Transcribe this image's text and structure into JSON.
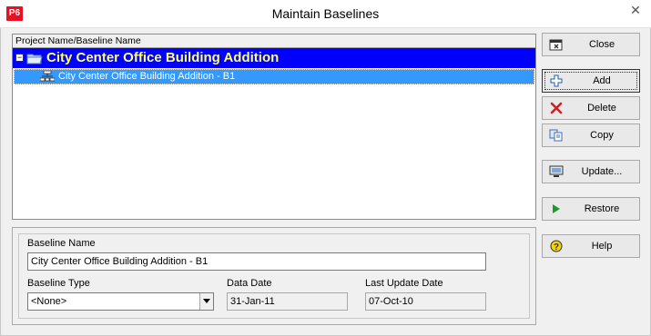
{
  "window": {
    "app_icon_text": "P6",
    "title": "Maintain Baselines"
  },
  "tree": {
    "column_header": "Project Name/Baseline Name",
    "project": {
      "name": "City Center Office Building Addition",
      "expanded": true
    },
    "baselines": [
      {
        "name": "City Center Office Building Addition - B1",
        "selected": true
      }
    ]
  },
  "details": {
    "baseline_name_label": "Baseline Name",
    "baseline_name_value": "City Center Office Building Addition - B1",
    "baseline_type_label": "Baseline Type",
    "baseline_type_value": "<None>",
    "data_date_label": "Data Date",
    "data_date_value": "31-Jan-11",
    "last_update_label": "Last Update Date",
    "last_update_value": "07-Oct-10"
  },
  "buttons": {
    "close": "Close",
    "add": "Add",
    "delete": "Delete",
    "copy": "Copy",
    "update": "Update...",
    "restore": "Restore",
    "help": "Help"
  },
  "colors": {
    "project_row_bg": "#0000ff",
    "project_text": "#ffff66",
    "selected_row_bg": "#3399ff",
    "app_icon": "#e81123"
  },
  "icons": {
    "app": "p6-app-icon",
    "window_close": "close-icon",
    "project": "folder-icon",
    "baseline": "baseline-icon",
    "close_button": "close-window-icon",
    "add_button": "plus-icon",
    "delete_button": "red-x-icon",
    "copy_button": "copy-icon",
    "update_button": "update-icon",
    "restore_button": "green-triangle-icon",
    "help_button": "question-icon"
  }
}
